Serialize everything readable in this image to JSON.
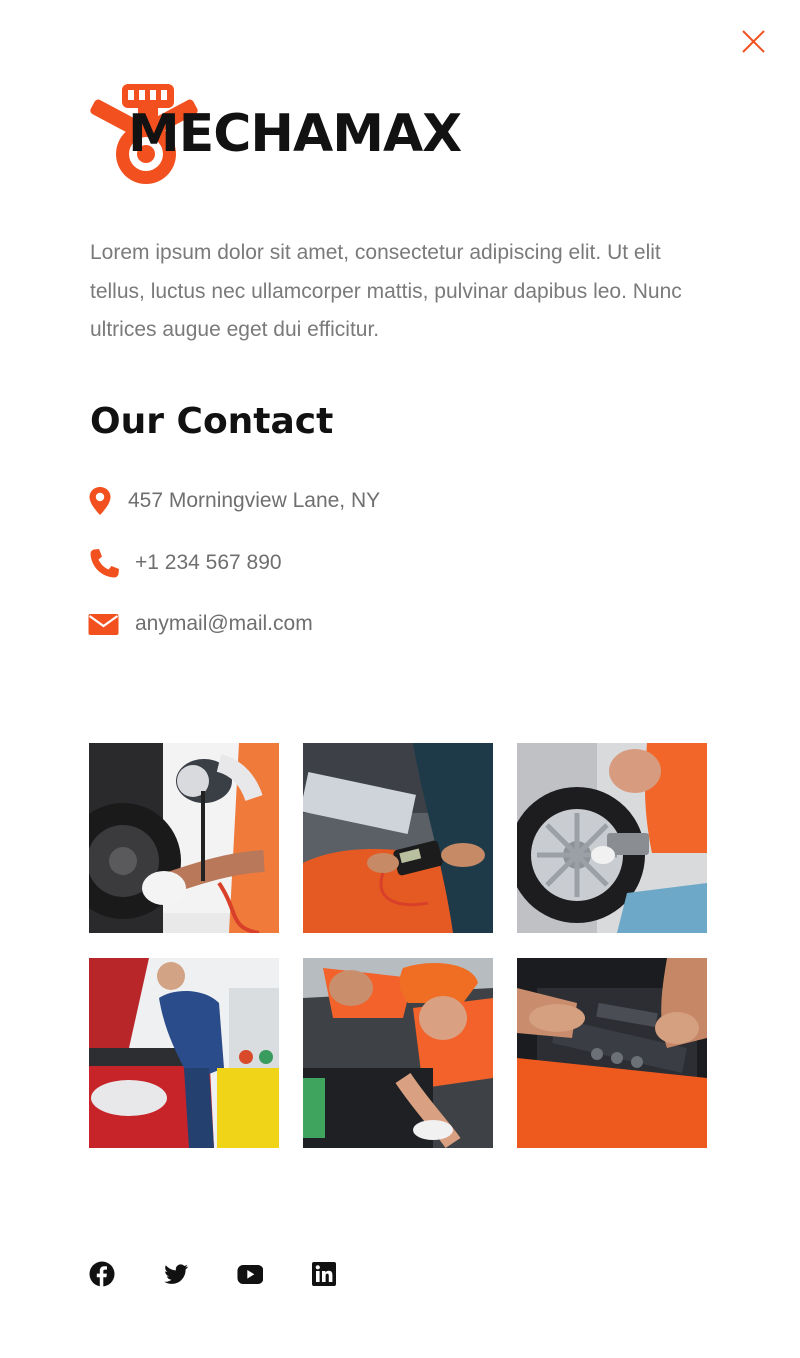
{
  "brand": {
    "name": "MECHAMAX",
    "accent_color": "#f2501f",
    "text_color": "#121212"
  },
  "intro_text": "Lorem ipsum dolor sit amet, consectetur adipiscing elit. Ut elit tellus, luctus nec ullamcorper mattis, pulvinar dapibus leo. Nunc ultrices augue eget dui efficitur.",
  "contact": {
    "heading": "Our Contact",
    "address": {
      "icon": "map-pin-icon",
      "text": "457 Morningview Lane, NY"
    },
    "phone": {
      "icon": "phone-icon",
      "text": "+1 234 567 890"
    },
    "email": {
      "icon": "envelope-icon",
      "text": "anymail@mail.com"
    }
  },
  "gallery": [
    {
      "subject": "tire-pressure-check"
    },
    {
      "subject": "multimeter-diagnostics"
    },
    {
      "subject": "wheel-repair"
    },
    {
      "subject": "engine-inspection"
    },
    {
      "subject": "mechanic-under-hood"
    },
    {
      "subject": "engine-closeup"
    }
  ],
  "social_links": [
    {
      "icon": "facebook-icon"
    },
    {
      "icon": "twitter-icon"
    },
    {
      "icon": "youtube-icon"
    },
    {
      "icon": "linkedin-icon"
    }
  ],
  "close_icon": "close-icon"
}
